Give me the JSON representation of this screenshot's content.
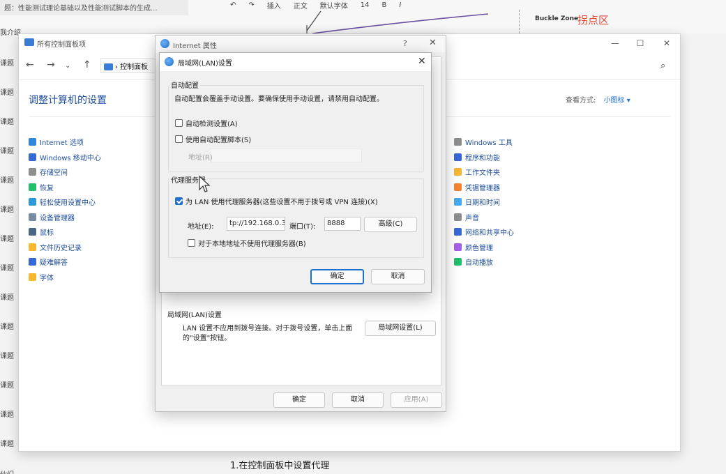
{
  "background": {
    "doc_title": "题：性能测试理论基础以及性能测试脚本的生成...",
    "tools": [
      "插入",
      "正文",
      "默认字体",
      "14"
    ],
    "buckle_zone": "Buckle Zone",
    "guaidian": "拐点区",
    "left_items": [
      "我介绍",
      "课题",
      "课题",
      "课题",
      "课题",
      "课题",
      "课题",
      "课题",
      "课题",
      "课题",
      "课题",
      "课题",
      "课题",
      "课题",
      "课题"
    ],
    "caption": "1.在控制面板中设置代理",
    "bottom_left": "伙们"
  },
  "control_panel": {
    "title": "所有控制面板项",
    "breadcrumb": "控制面板",
    "heading": "调整计算机的设置",
    "view_label": "查看方式:",
    "view_value": "小图标 ▾",
    "left_items": [
      {
        "label": "Internet 选项",
        "color": "#2e86de"
      },
      {
        "label": "Windows 移动中心",
        "color": "#3867d6"
      },
      {
        "label": "存储空间",
        "color": "#8e8e8e"
      },
      {
        "label": "恢复",
        "color": "#20bf6b"
      },
      {
        "label": "轻松使用设置中心",
        "color": "#2d98da"
      },
      {
        "label": "设备管理器",
        "color": "#778ca3"
      },
      {
        "label": "鼠标",
        "color": "#4b6584"
      },
      {
        "label": "文件历史记录",
        "color": "#f7b731"
      },
      {
        "label": "疑难解答",
        "color": "#3867d6"
      },
      {
        "label": "字体",
        "color": "#f7b731"
      }
    ],
    "right_items": [
      {
        "label": "Windows 工具",
        "color": "#8e8e8e"
      },
      {
        "label": "程序和功能",
        "color": "#3867d6"
      },
      {
        "label": "工作文件夹",
        "color": "#f7b731"
      },
      {
        "label": "凭据管理器",
        "color": "#fa8231"
      },
      {
        "label": "日期和时间",
        "color": "#45aaf2"
      },
      {
        "label": "声音",
        "color": "#8e8e8e"
      },
      {
        "label": "网络和共享中心",
        "color": "#3867d6"
      },
      {
        "label": "颜色管理",
        "color": "#a55eea"
      },
      {
        "label": "自动播放",
        "color": "#20bf6b"
      }
    ]
  },
  "internet_properties": {
    "title": "Internet 属性",
    "help": "?",
    "lan_section_label": "局域网(LAN)设置",
    "lan_text": "LAN 设置不应用到拨号连接。对于拨号设置，单击上面的\"设置\"按钮。",
    "lan_button": "局域网设置(L)",
    "ok": "确定",
    "cancel": "取消",
    "apply": "应用(A)"
  },
  "lan_dialog": {
    "title": "局域网(LAN)设置",
    "auto_group": "自动配置",
    "auto_desc": "自动配置会覆盖手动设置。要确保使用手动设置，请禁用自动配置。",
    "auto_detect": "自动检测设置(A)",
    "auto_detect_checked": false,
    "use_script": "使用自动配置脚本(S)",
    "use_script_checked": false,
    "script_address_label": "地址(R)",
    "proxy_group": "代理服务器",
    "use_proxy": "为 LAN 使用代理服务器(这些设置不用于拨号或 VPN 连接)(X)",
    "use_proxy_checked": true,
    "address_label": "地址(E):",
    "address_value": "tp://192.168.0.3",
    "port_label": "端口(T):",
    "port_value": "8888",
    "advanced": "高级(C)",
    "bypass_local": "对于本地地址不使用代理服务器(B)",
    "bypass_local_checked": false,
    "ok": "确定",
    "cancel": "取消"
  },
  "colors": {
    "accent": "#1f6fcf",
    "link": "#1f4e99",
    "annotation_red": "#e24a3b"
  }
}
